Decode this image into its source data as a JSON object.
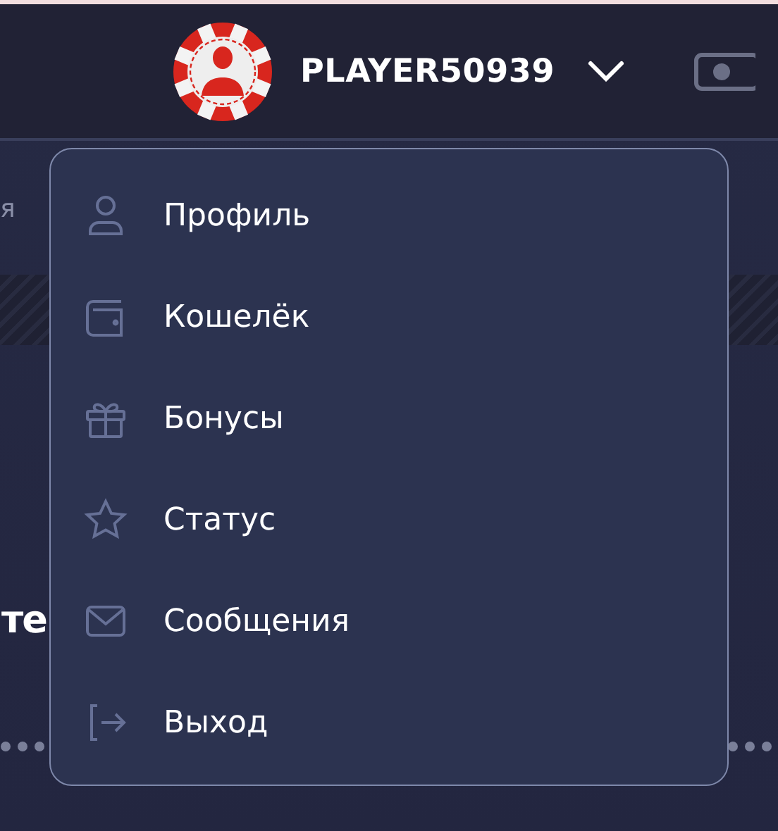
{
  "header": {
    "username": "PLAYER50939",
    "menu_expanded": true
  },
  "background": {
    "nav_fragment": "я",
    "heading_fragment": "те"
  },
  "menu": [
    {
      "kind": "profile",
      "label": "Профиль"
    },
    {
      "kind": "wallet",
      "label": "Кошелёк"
    },
    {
      "kind": "gift",
      "label": "Бонусы"
    },
    {
      "kind": "star",
      "label": "Статус"
    },
    {
      "kind": "mail",
      "label": "Сообщения"
    },
    {
      "kind": "logout",
      "label": "Выход"
    }
  ]
}
